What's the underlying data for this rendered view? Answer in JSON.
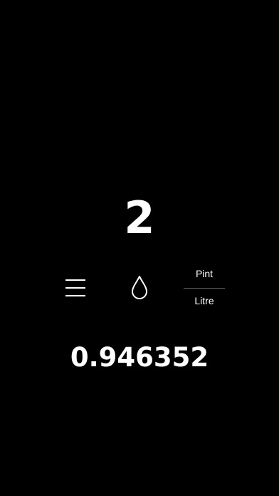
{
  "converter": {
    "input_value": "2",
    "from_unit": "Pint",
    "to_unit": "Litre",
    "result_value": "0.946352"
  },
  "icons": {
    "menu": "hamburger-menu-icon",
    "category": "water-drop-icon"
  },
  "colors": {
    "background": "#000000",
    "text": "#ffffff",
    "divider": "#5a5a5a"
  }
}
